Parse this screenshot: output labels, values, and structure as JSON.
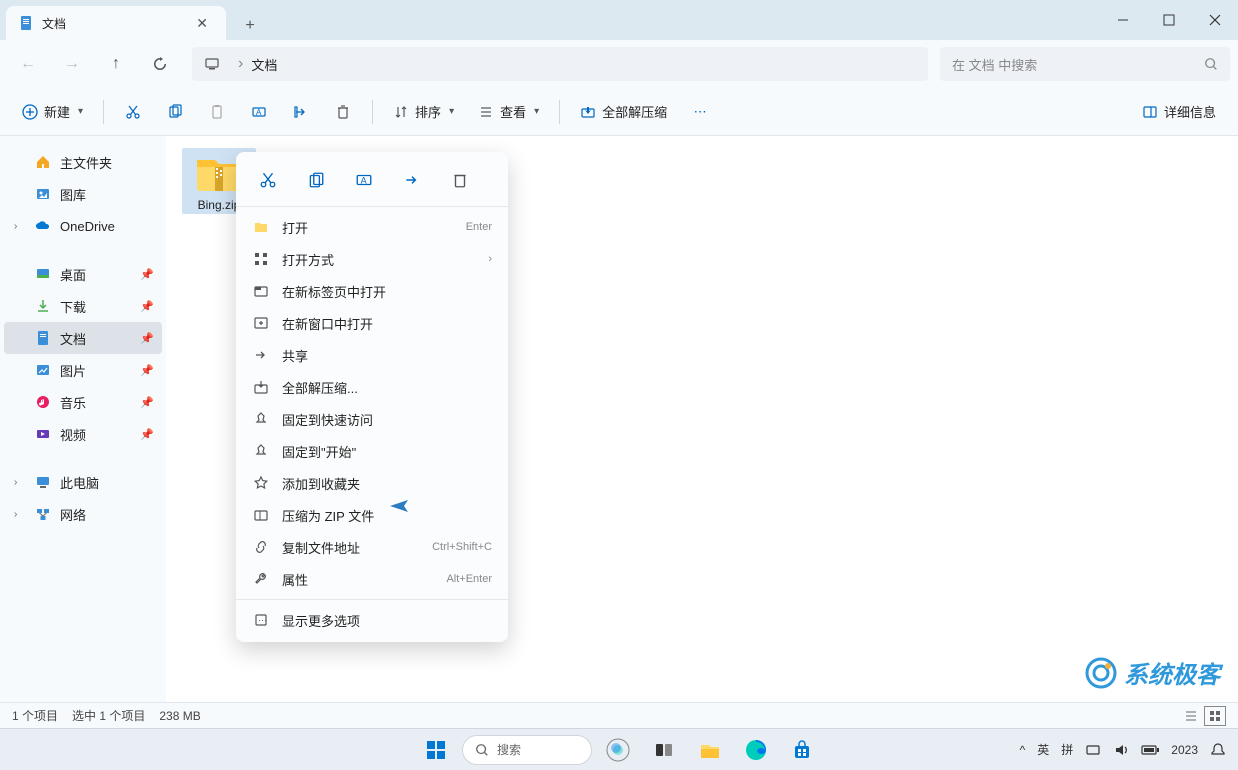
{
  "tab": {
    "title": "文档"
  },
  "path": {
    "current": "文档"
  },
  "search": {
    "placeholder": "在 文档 中搜索"
  },
  "toolbar": {
    "new": "新建",
    "sort": "排序",
    "view": "查看",
    "extract_all": "全部解压缩",
    "details": "详细信息"
  },
  "sidebar": {
    "home": "主文件夹",
    "gallery": "图库",
    "onedrive": "OneDrive",
    "desktop": "桌面",
    "downloads": "下载",
    "documents": "文档",
    "pictures": "图片",
    "music": "音乐",
    "videos": "视频",
    "this_pc": "此电脑",
    "network": "网络"
  },
  "file": {
    "name": "Bing.zip"
  },
  "context_menu": {
    "open": "打开",
    "open_shortcut": "Enter",
    "open_with": "打开方式",
    "open_new_tab": "在新标签页中打开",
    "open_new_window": "在新窗口中打开",
    "share": "共享",
    "extract_all": "全部解压缩...",
    "pin_quick": "固定到快速访问",
    "pin_start": "固定到\"开始\"",
    "add_favorite": "添加到收藏夹",
    "compress_zip": "压缩为 ZIP 文件",
    "copy_path": "复制文件地址",
    "copy_path_shortcut": "Ctrl+Shift+C",
    "properties": "属性",
    "properties_shortcut": "Alt+Enter",
    "more_options": "显示更多选项"
  },
  "status": {
    "count": "1 个项目",
    "selected": "选中 1 个项目",
    "size": "238 MB"
  },
  "watermark": "系统极客",
  "taskbar": {
    "search": "搜索",
    "ime1": "英",
    "ime2": "拼",
    "year": "2023"
  }
}
